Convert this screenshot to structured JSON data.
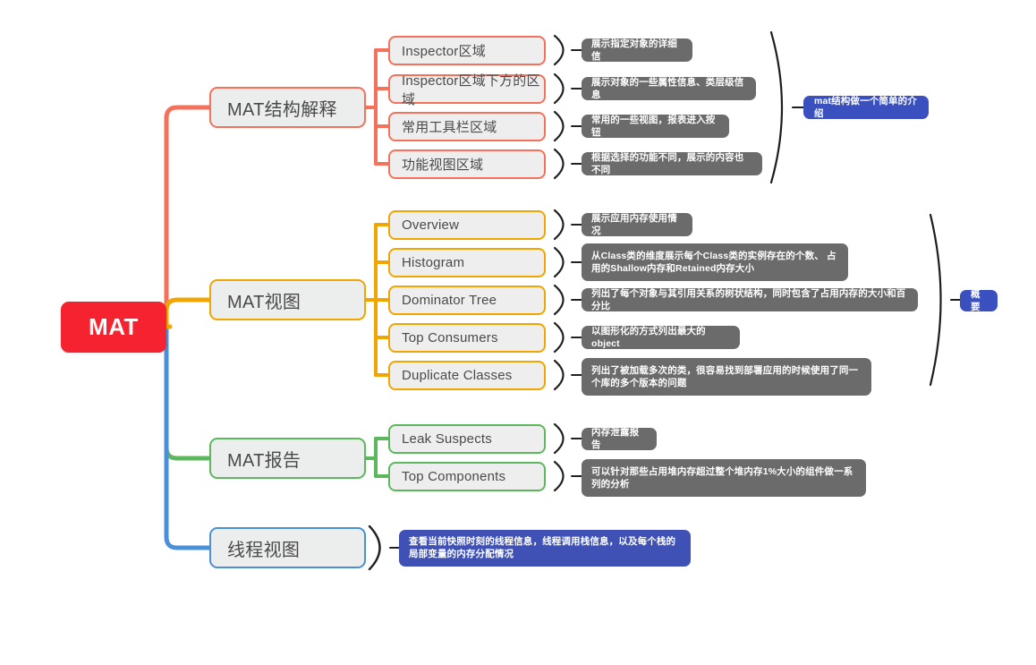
{
  "mindmap": {
    "root": {
      "label": "MAT",
      "color": "#f5232f"
    },
    "branches": [
      {
        "id": "structure",
        "label": "MAT结构解释",
        "color": "#f4715b",
        "summary": "mat结构做一个简单的介绍",
        "children": [
          {
            "label": "Inspector区域",
            "note": "展示指定对象的详细信"
          },
          {
            "label": "Inspector区域下方的区域",
            "note": "展示对象的一些属性信息、类层级信息"
          },
          {
            "label": "常用工具栏区域",
            "note": "常用的一些视图，报表进入按钮"
          },
          {
            "label": "功能视图区域",
            "note": "根据选择的功能不同，展示的内容也不同"
          }
        ]
      },
      {
        "id": "views",
        "label": "MAT视图",
        "color": "#f0a500",
        "summary": "概要",
        "children": [
          {
            "label": "Overview",
            "note": "展示应用内存使用情况"
          },
          {
            "label": "Histogram",
            "note": "从Class类的维度展示每个Class类的实例存在的个数、 占用的Shallow内存和Retained内存大小"
          },
          {
            "label": "Dominator Tree",
            "note": "列出了每个对象与其引用关系的树状结构，同时包含了占用内存的大小和百分比"
          },
          {
            "label": "Top Consumers",
            "note": "以图形化的方式列出最大的object"
          },
          {
            "label": "Duplicate Classes",
            "note": "列出了被加载多次的类，很容易找到部署应用的时候使用了同一个库的多个版本的问题"
          }
        ]
      },
      {
        "id": "report",
        "label": "MAT报告",
        "color": "#5cb85c",
        "summary": "",
        "children": [
          {
            "label": "Leak Suspects",
            "note": "内存泄露报告"
          },
          {
            "label": "Top Components",
            "note": "可以针对那些占用堆内存超过整个堆内存1%大小的组件做一系列的分析"
          }
        ]
      },
      {
        "id": "thread",
        "label": "线程视图",
        "color": "#4a90d9",
        "summary": "",
        "children": [],
        "note": "查看当前快照时刻的线程信息，线程调用栈信息，以及每个栈的局部变量的内存分配情况"
      }
    ]
  }
}
